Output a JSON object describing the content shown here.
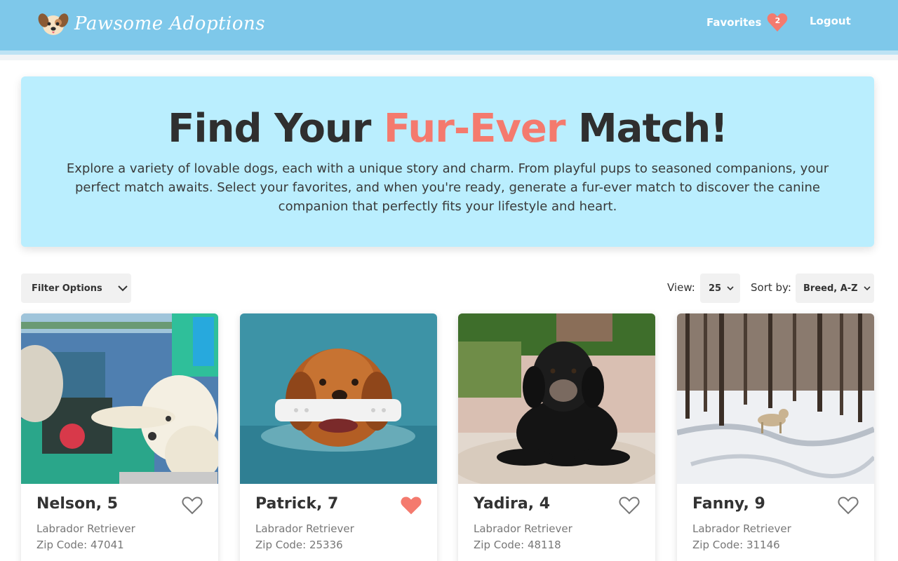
{
  "header": {
    "app_title": "Pawsome Adoptions",
    "favorites_label": "Favorites",
    "favorites_count": "2",
    "logout_label": "Logout"
  },
  "hero": {
    "title_part1": "Find Your ",
    "title_accent": "Fur-Ever",
    "title_part2": " Match!",
    "description": "Explore a variety of lovable dogs, each with a unique story and charm. From playful pups to seasoned companions, your perfect match awaits. Select your favorites, and when you're ready, generate a fur-ever match to discover the canine companion that perfectly fits your lifestyle and heart."
  },
  "controls": {
    "filter_label": "Filter Options",
    "view_label": "View:",
    "view_value": "25",
    "sort_label": "Sort by:",
    "sort_value": "Breed, A-Z"
  },
  "dogs": [
    {
      "name": "Nelson, 5",
      "breed": "Labrador Retriever",
      "zip": "Zip Code: 47041",
      "favorited": false
    },
    {
      "name": "Patrick, 7",
      "breed": "Labrador Retriever",
      "zip": "Zip Code: 25336",
      "favorited": true
    },
    {
      "name": "Yadira, 4",
      "breed": "Labrador Retriever",
      "zip": "Zip Code: 48118",
      "favorited": false
    },
    {
      "name": "Fanny, 9",
      "breed": "Labrador Retriever",
      "zip": "Zip Code: 31146",
      "favorited": false
    }
  ],
  "colors": {
    "header_bg": "#7ec8ea",
    "hero_bg": "#baeefe",
    "accent": "#f47a6e",
    "heart_active": "#f47a6e",
    "heart_inactive": "#777777"
  }
}
